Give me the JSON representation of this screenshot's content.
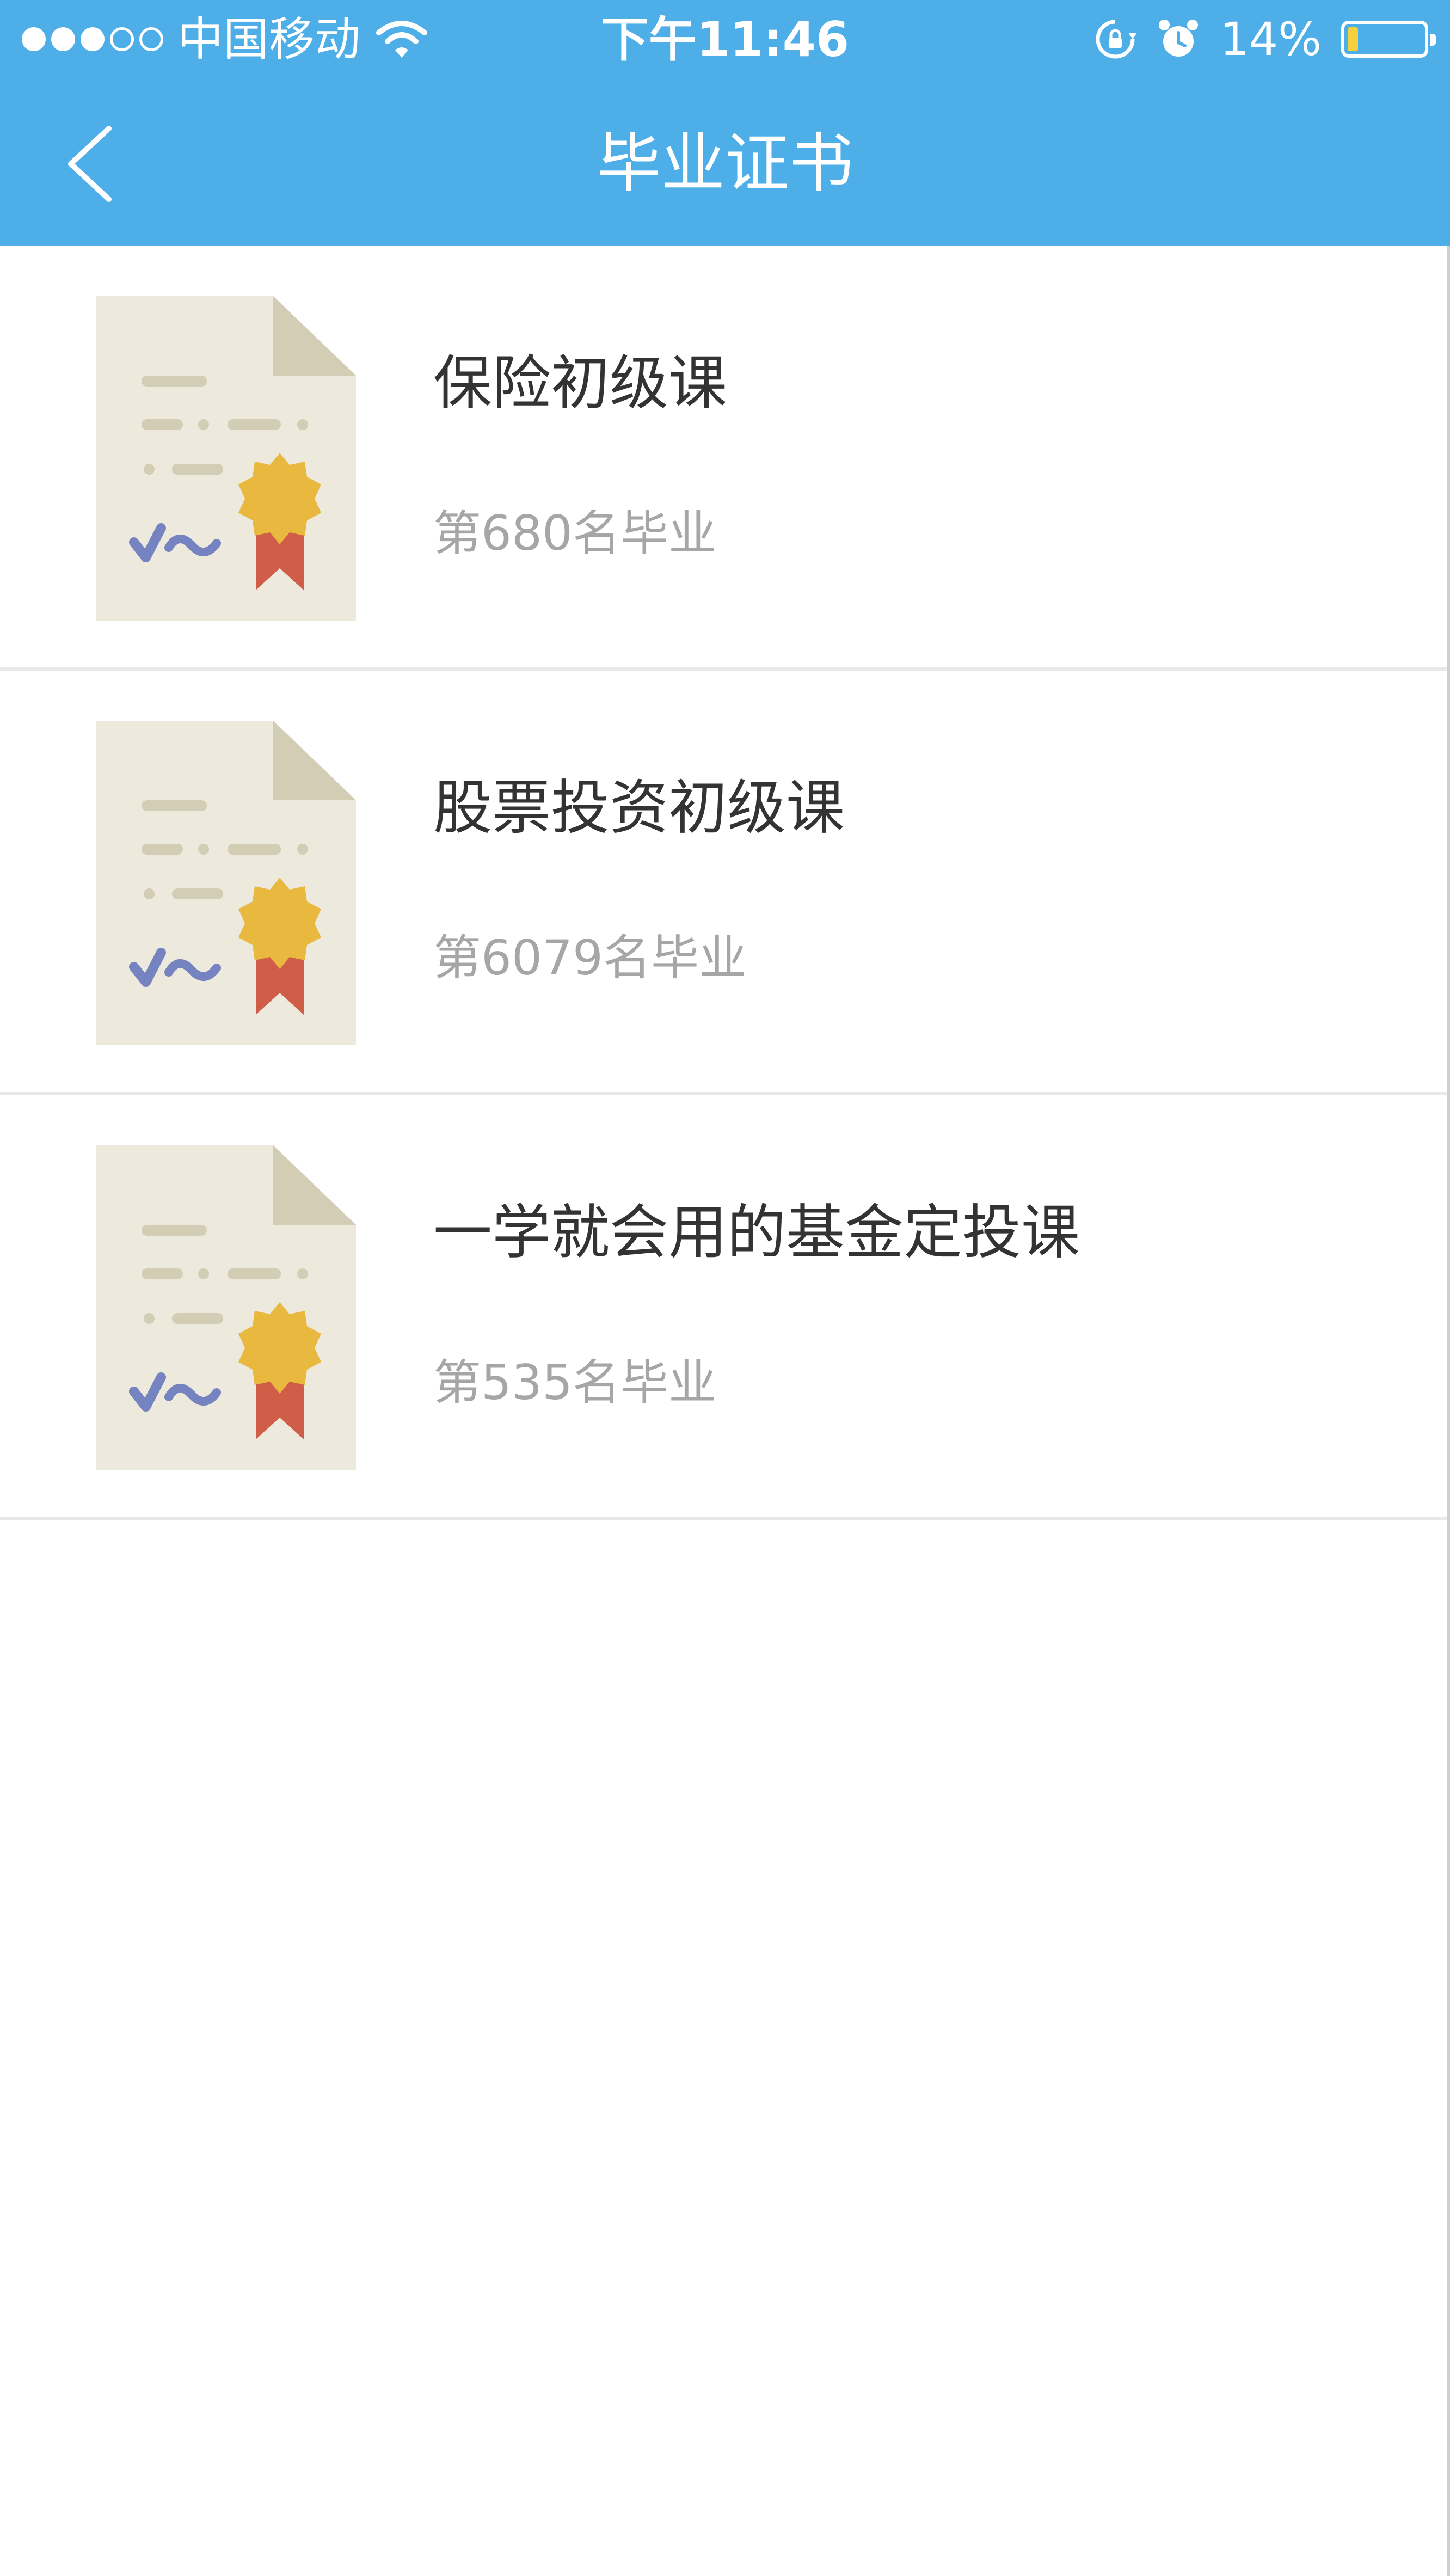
{
  "status_bar": {
    "carrier": "中国移动",
    "time": "下午11:46",
    "battery_percent_label": "14%",
    "battery_level": 0.14,
    "signal_bars_filled": 3,
    "signal_bars_total": 5,
    "icons": [
      "wifi-icon",
      "rotation-lock-icon",
      "alarm-icon",
      "battery-icon"
    ]
  },
  "nav": {
    "title": "毕业证书",
    "back_icon": "chevron-left-icon"
  },
  "colors": {
    "accent": "#4daee8",
    "title_text": "#333333",
    "subtitle_text": "#a6a6a6",
    "certificate_paper": "#ede9dc",
    "certificate_fold": "#d2cdb4",
    "seal": "#e8b83f",
    "ribbon": "#cf5d48",
    "signature": "#7683c1"
  },
  "certificates": [
    {
      "title": "保险初级课",
      "subtitle": "第680名毕业"
    },
    {
      "title": "股票投资初级课",
      "subtitle": "第6079名毕业"
    },
    {
      "title": "一学就会用的基金定投课",
      "subtitle": "第535名毕业"
    }
  ]
}
